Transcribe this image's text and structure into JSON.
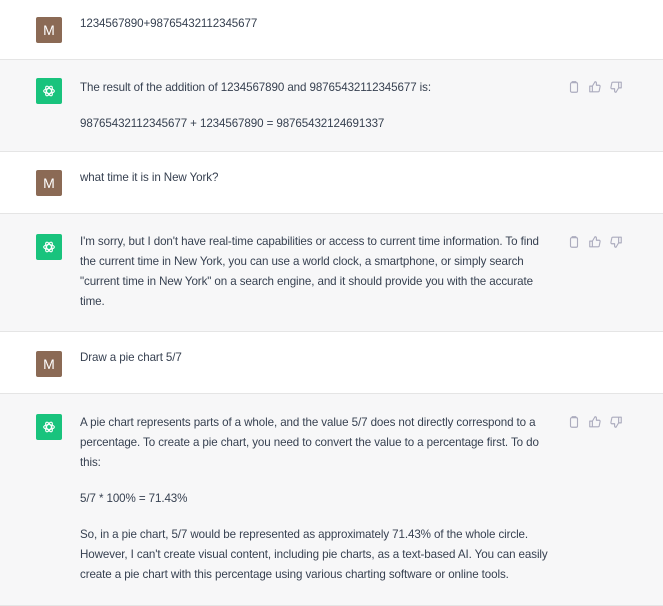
{
  "messages": [
    {
      "role": "user",
      "avatar_letter": "M",
      "text": "1234567890+98765432112345677"
    },
    {
      "role": "assistant",
      "paragraphs": [
        "The result of the addition of 1234567890 and 98765432112345677 is:",
        "98765432112345677 + 1234567890 = 98765432124691337"
      ]
    },
    {
      "role": "user",
      "avatar_letter": "M",
      "text": "what time it is in New York?"
    },
    {
      "role": "assistant",
      "paragraphs": [
        "I'm sorry, but I don't have real-time capabilities or access to current time information. To find the current time in New York, you can use a world clock, a smartphone, or simply search \"current time in New York\" on a search engine, and it should provide you with the accurate time."
      ]
    },
    {
      "role": "user",
      "avatar_letter": "M",
      "text": "Draw a pie chart 5/7"
    },
    {
      "role": "assistant",
      "paragraphs": [
        "A pie chart represents parts of a whole, and the value 5/7 does not directly correspond to a percentage. To create a pie chart, you need to convert the value to a percentage first. To do this:",
        "5/7 * 100% = 71.43%",
        "So, in a pie chart, 5/7 would be represented as approximately 71.43% of the whole circle. However, I can't create visual content, including pie charts, as a text-based AI. You can easily create a pie chart with this percentage using various charting software or online tools."
      ]
    }
  ],
  "icons": {
    "assistant_avatar": "openai-logo-icon",
    "actions": [
      "copy-icon",
      "thumbs-up-icon",
      "thumbs-down-icon"
    ]
  },
  "colors": {
    "user_avatar": "#8b6a55",
    "assistant_avatar": "#19c37d",
    "assistant_bg": "#f7f7f8"
  }
}
